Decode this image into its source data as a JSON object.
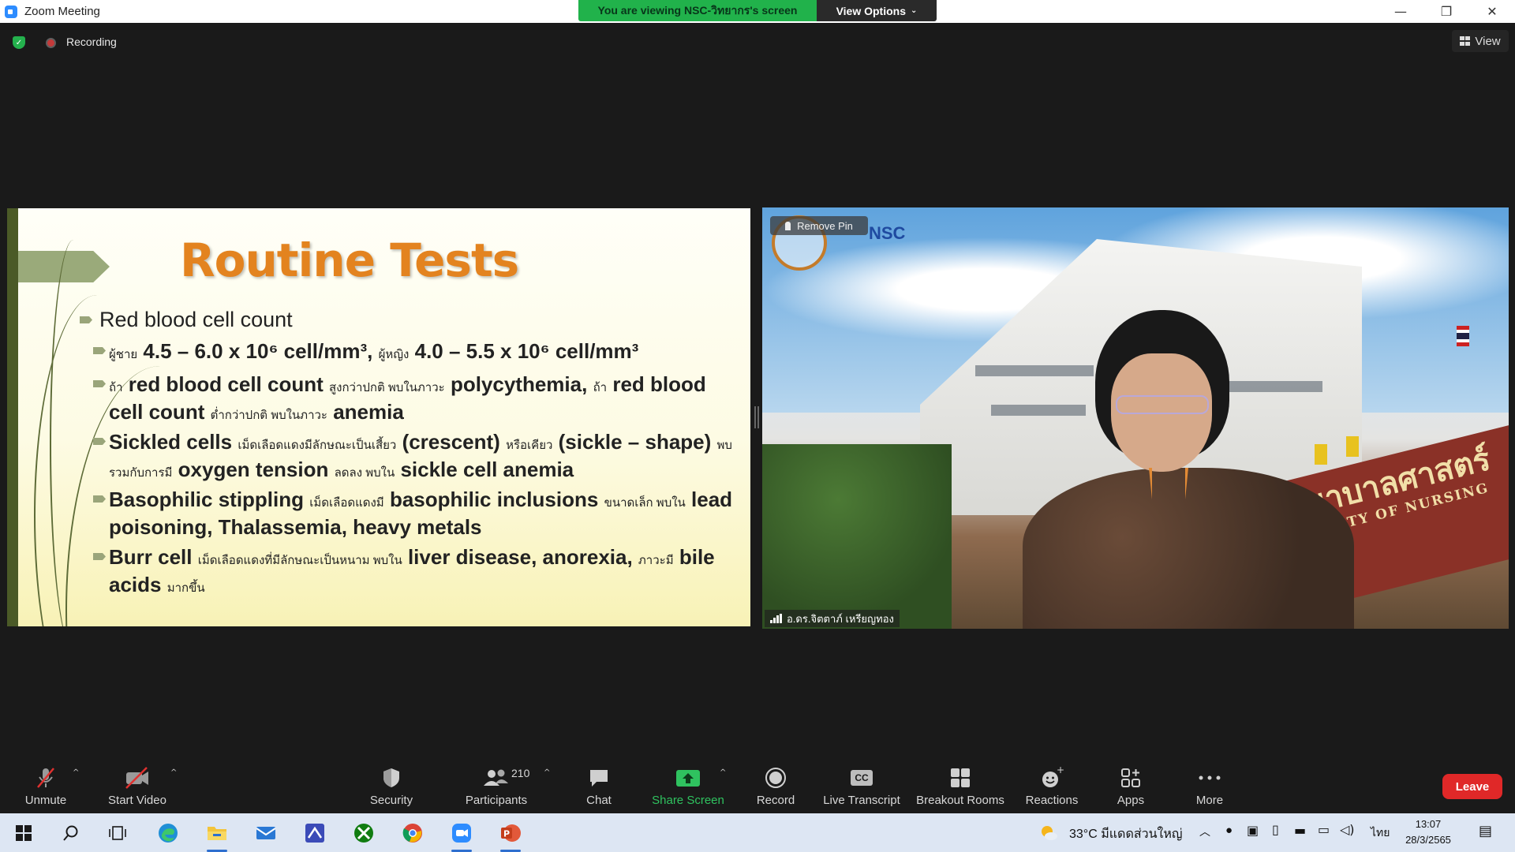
{
  "window": {
    "title": "Zoom Meeting",
    "controls": {
      "minimize": "—",
      "restore": "❐",
      "close": "✕"
    }
  },
  "share_banner": {
    "viewing_text": "You are viewing NSC-วิทยากร's screen",
    "view_options_label": "View Options"
  },
  "status": {
    "recording_label": "Recording",
    "view_label": "View"
  },
  "slide": {
    "title": "Routine Tests",
    "bullet_main": "Red blood cell count",
    "sub1": {
      "a": "ผู้ชาย",
      "b": "4.5 – 6.0 x 10⁶ cell/mm³,",
      "c": "ผู้หญิง",
      "d": "4.0 – 5.5 x 10⁶ cell/mm³"
    },
    "sub2": {
      "a": "ถ้า",
      "b": "red blood cell count",
      "c": "สูงกว่าปกติ พบในภาวะ",
      "d": "polycythemia,",
      "e": "ถ้า",
      "f": "red blood cell count",
      "g": "ต่ำกว่าปกติ พบในภาวะ",
      "h": "anemia"
    },
    "sub3": {
      "a": "Sickled cells",
      "b": "เม็ดเลือดแดงมีลักษณะเป็นเสี้ยว",
      "c": "(crescent)",
      "d": "หรือเคียว",
      "e": "(sickle – shape)",
      "f": "พบรวมกับการมี",
      "g": "oxygen tension",
      "h": "ลดลง พบใน",
      "i": "sickle cell anemia"
    },
    "sub4": {
      "a": "Basophilic stippling",
      "b": "เม็ดเลือดแดงมี",
      "c": "basophilic inclusions",
      "d": "ขนาดเล็ก  พบใน",
      "e": "lead poisoning, Thalassemia, heavy metals"
    },
    "sub5": {
      "a": "Burr cell",
      "b": "เม็ดเลือดแดงที่มีลักษณะเป็นหนาม พบใน",
      "c": "liver disease, anorexia,",
      "d": "ภาวะมี",
      "e": "bile acids",
      "f": "มากขึ้น"
    }
  },
  "video": {
    "remove_pin_label": "Remove Pin",
    "logo_text": "NSC",
    "participant_name": "อ.ดร.จิตตาภ์ เหรียญทอง",
    "sign_thai": "ะพยาบาลศาสตร์",
    "sign_en": "ACULTY OF NURSING"
  },
  "toolbar": {
    "unmute": "Unmute",
    "start_video": "Start Video",
    "security": "Security",
    "participants": "Participants",
    "participants_count": "210",
    "chat": "Chat",
    "share_screen": "Share Screen",
    "record": "Record",
    "live_transcript": "Live Transcript",
    "live_transcript_badge": "CC",
    "breakout_rooms": "Breakout Rooms",
    "reactions": "Reactions",
    "apps": "Apps",
    "more": "More",
    "leave": "Leave"
  },
  "taskbar": {
    "weather": "33°C  มีแดดส่วนใหญ่",
    "language": "ไทย",
    "time": "13:07",
    "date": "28/3/2565"
  },
  "colors": {
    "share_banner": "#21b24b",
    "slide_title": "#e3831f",
    "leave": "#e02828",
    "share_icon": "#2fc25f"
  }
}
